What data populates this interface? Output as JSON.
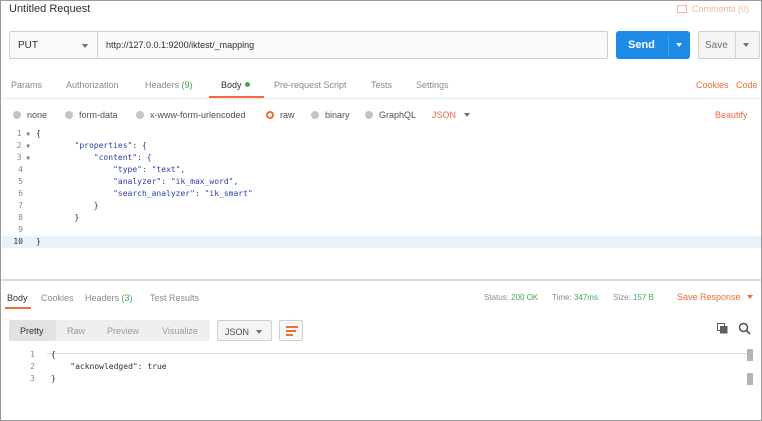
{
  "title_bar": {
    "request_title": "Untitled Request",
    "comments_label": "Comments (0)"
  },
  "url_bar": {
    "method": "PUT",
    "url": "http://127.0.0.1:9200/iktest/_mapping",
    "send_label": "Send",
    "save_label": "Save"
  },
  "request_tabs": [
    {
      "label": "Params",
      "count": ""
    },
    {
      "label": "Authorization",
      "count": ""
    },
    {
      "label": "Headers",
      "count": "(9)"
    },
    {
      "label": "Body",
      "count": "",
      "active": true
    },
    {
      "label": "Pre-request Script",
      "count": ""
    },
    {
      "label": "Tests",
      "count": ""
    },
    {
      "label": "Settings",
      "count": ""
    }
  ],
  "request_links": {
    "cookies": "Cookies",
    "code": "Code",
    "beautify": "Beautify"
  },
  "body_types": [
    {
      "label": "none",
      "selected": false
    },
    {
      "label": "form-data",
      "selected": false
    },
    {
      "label": "x-www-form-urlencoded",
      "selected": false
    },
    {
      "label": "raw",
      "selected": true
    },
    {
      "label": "binary",
      "selected": false
    },
    {
      "label": "GraphQL",
      "selected": false
    }
  ],
  "raw_format": "JSON",
  "editor": {
    "line_numbers": [
      "1",
      "2",
      "3",
      "4",
      "5",
      "6",
      "7",
      "8",
      "9",
      "10"
    ],
    "lines": [
      "{",
      "        \"properties\": {",
      "            \"content\": {",
      "                \"type\": \"text\",",
      "                \"analyzer\": \"ik_max_word\",",
      "                \"search_analyzer\": \"ik_smart\"",
      "            }",
      "        }",
      "",
      "}"
    ],
    "active_line": 10
  },
  "response_tabs": [
    {
      "label": "Body",
      "count": "",
      "active": true
    },
    {
      "label": "Cookies",
      "count": ""
    },
    {
      "label": "Headers",
      "count": "(3)"
    },
    {
      "label": "Test Results",
      "count": ""
    }
  ],
  "response_meta": {
    "status_label": "Status:",
    "status_value": "200 OK",
    "time_label": "Time:",
    "time_value": "347ms",
    "size_label": "Size:",
    "size_value": "157 B",
    "save_response": "Save Response"
  },
  "view_modes": [
    "Pretty",
    "Raw",
    "Preview",
    "Visualize"
  ],
  "response_format": "JSON",
  "response_body": {
    "line_numbers": [
      "1",
      "2",
      "3"
    ],
    "lines": [
      "{",
      "    \"acknowledged\": true",
      "}"
    ]
  },
  "icons": [
    "comment-icon",
    "wrap-lines-icon",
    "copy-icon",
    "search-icon"
  ],
  "colors": {
    "accent": "#f26b3a",
    "send": "#1e8ae6",
    "success": "#3eaa57"
  }
}
